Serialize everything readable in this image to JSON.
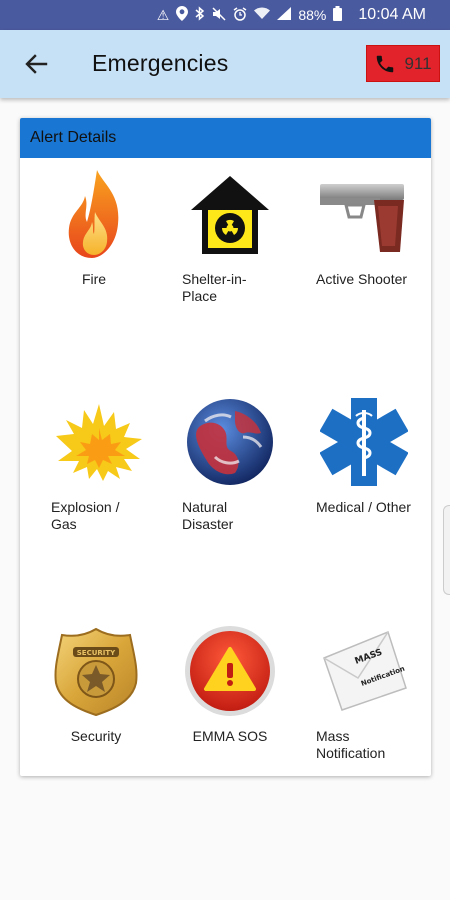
{
  "status_bar": {
    "battery": "88%",
    "time": "10:04 AM"
  },
  "header": {
    "title": "Emergencies",
    "call_label": "911"
  },
  "card": {
    "title": "Alert Details"
  },
  "alerts": [
    {
      "label": "Fire",
      "icon": "fire-icon"
    },
    {
      "label": "Shelter-in-Place",
      "icon": "radiation-shelter-icon"
    },
    {
      "label": "Active Shooter",
      "icon": "handgun-icon"
    },
    {
      "label": "Explosion / Gas",
      "icon": "explosion-icon"
    },
    {
      "label": "Natural Disaster",
      "icon": "globe-icon"
    },
    {
      "label": "Medical / Other",
      "icon": "star-of-life-icon"
    },
    {
      "label": "Security",
      "icon": "security-badge-icon",
      "badge_text": "SECURITY"
    },
    {
      "label": "EMMA SOS",
      "icon": "warning-sos-icon"
    },
    {
      "label": "Mass Notification",
      "icon": "mass-notification-icon",
      "envelope_text_1": "MASS",
      "envelope_text_2": "Notification"
    }
  ]
}
